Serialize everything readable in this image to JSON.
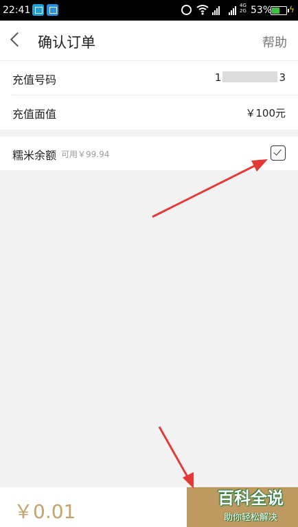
{
  "status_bar": {
    "time": "22:41",
    "network_label": "4G\n2G",
    "battery_percent": "53%",
    "battery_level": 0.53
  },
  "header": {
    "title": "确认订单",
    "help_label": "帮助"
  },
  "order": {
    "phone_label": "充值号码",
    "phone_value_start": "1",
    "phone_value_end": "3",
    "denomination_label": "充值面值",
    "denomination_value": "￥100元"
  },
  "balance": {
    "label": "糯米余额",
    "available": "可用￥99.94",
    "checked": true
  },
  "footer": {
    "pay_amount": "￥0.01"
  },
  "watermark": {
    "main": "百科全说",
    "sub": "助你轻松解决"
  },
  "colors": {
    "accent_gold": "#bf9a60",
    "annotation_red": "#e53935"
  }
}
